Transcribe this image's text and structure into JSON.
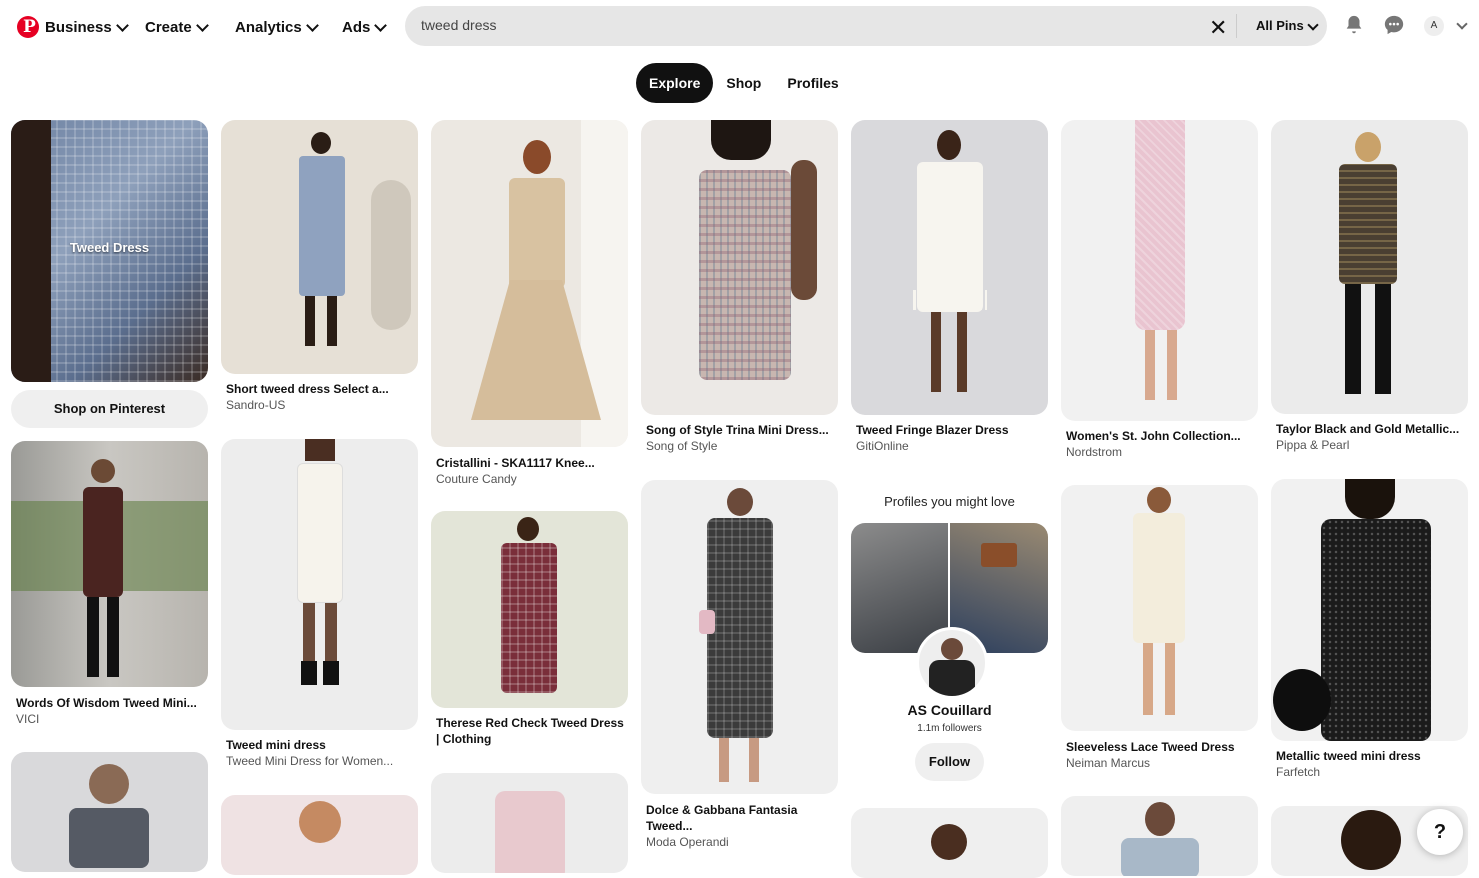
{
  "header": {
    "nav": [
      {
        "label": "Business"
      },
      {
        "label": "Create"
      },
      {
        "label": "Analytics"
      },
      {
        "label": "Ads"
      }
    ],
    "search": {
      "value": "tweed dress",
      "filter": "All Pins"
    },
    "avatar_letter": "A"
  },
  "tabs": [
    {
      "label": "Explore",
      "active": true
    },
    {
      "label": "Shop",
      "active": false
    },
    {
      "label": "Profiles",
      "active": false
    }
  ],
  "pins": {
    "c1a": {
      "overlay": "Tweed Dress",
      "button": "Shop on Pinterest"
    },
    "c1b": {
      "title": "Words Of Wisdom Tweed Mini...",
      "source": "VICI"
    },
    "c2a": {
      "title": "Short tweed dress Select a...",
      "source": "Sandro-US"
    },
    "c2b": {
      "title": "Tweed mini dress",
      "source": "Tweed Mini Dress for Women..."
    },
    "c3a": {
      "title": "Cristallini - SKA1117 Knee...",
      "source": "Couture Candy"
    },
    "c3b": {
      "title": "Therese Red Check Tweed Dress | Clothing",
      "source": ""
    },
    "c4a": {
      "title": "Song of Style Trina Mini Dress...",
      "source": "Song of Style"
    },
    "c4b": {
      "title": "Dolce & Gabbana Fantasia Tweed...",
      "source": "Moda Operandi"
    },
    "c5a": {
      "title": "Tweed Fringe Blazer Dress",
      "source": "GitiOnline"
    },
    "c6a": {
      "title": "Women's St. John Collection...",
      "source": "Nordstrom"
    },
    "c6b": {
      "title": "Sleeveless Lace Tweed Dress",
      "source": "Neiman Marcus"
    },
    "c7a": {
      "title": "Taylor Black and Gold Metallic...",
      "source": "Pippa & Pearl"
    },
    "c7b": {
      "title": "Metallic tweed mini dress",
      "source": "Farfetch"
    }
  },
  "profile_card": {
    "heading": "Profiles you might love",
    "name": "AS Couillard",
    "followers": "1.1m followers",
    "button": "Follow"
  },
  "help": "?",
  "colors": {
    "brand": "#e60023",
    "active_tab": "#111111",
    "search_bg": "#e6e6e6"
  }
}
